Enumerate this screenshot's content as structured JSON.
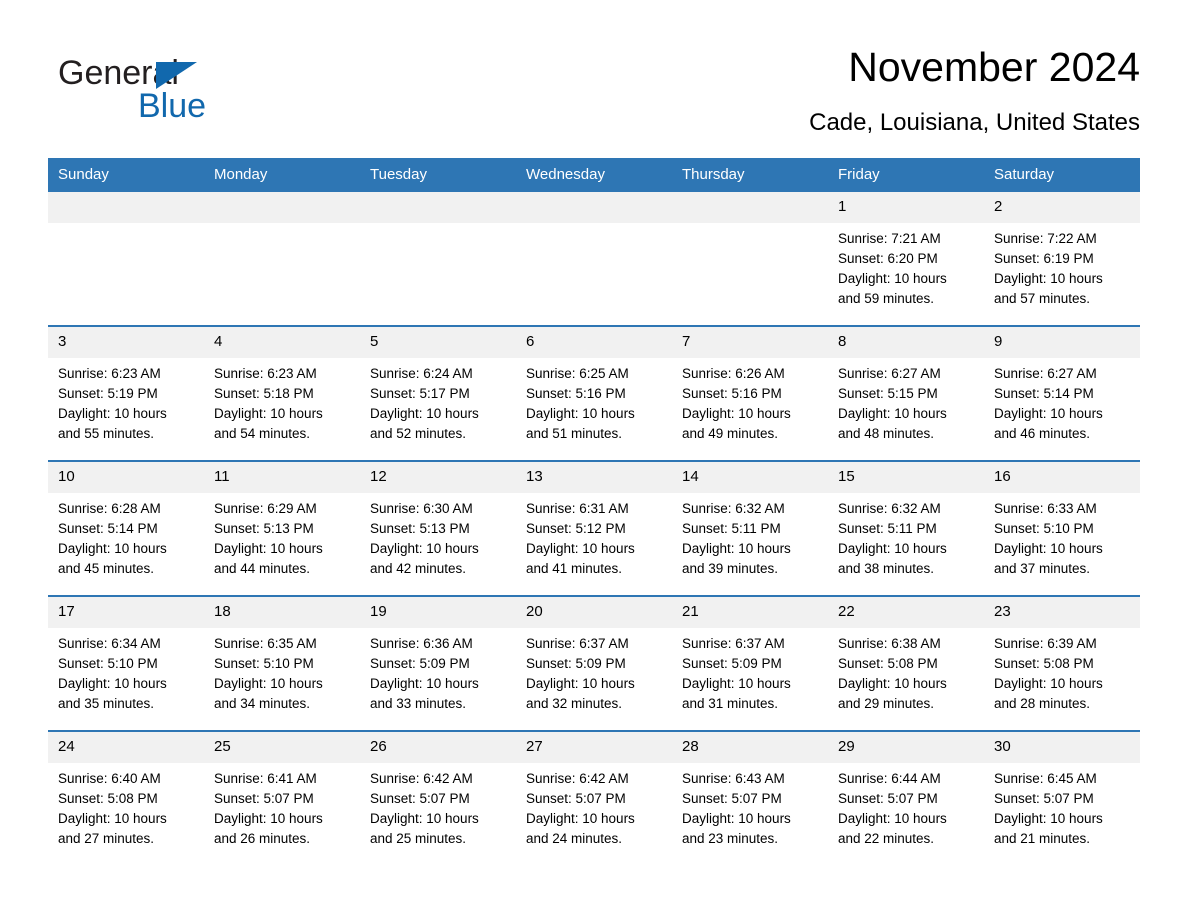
{
  "brand": {
    "name_part1": "General",
    "name_part2": "Blue",
    "triangle_icon": "triangle-icon",
    "accent_color": "#1168ad"
  },
  "header": {
    "month_title": "November 2024",
    "location": "Cade, Louisiana, United States"
  },
  "theme": {
    "header_blue": "#2e76b4",
    "daynum_band": "#f1f1f1",
    "text": "#000000"
  },
  "weekdays": [
    "Sunday",
    "Monday",
    "Tuesday",
    "Wednesday",
    "Thursday",
    "Friday",
    "Saturday"
  ],
  "weeks": [
    [
      {
        "day": "",
        "sunrise": "",
        "sunset": "",
        "daylight_line1": "",
        "daylight_line2": ""
      },
      {
        "day": "",
        "sunrise": "",
        "sunset": "",
        "daylight_line1": "",
        "daylight_line2": ""
      },
      {
        "day": "",
        "sunrise": "",
        "sunset": "",
        "daylight_line1": "",
        "daylight_line2": ""
      },
      {
        "day": "",
        "sunrise": "",
        "sunset": "",
        "daylight_line1": "",
        "daylight_line2": ""
      },
      {
        "day": "",
        "sunrise": "",
        "sunset": "",
        "daylight_line1": "",
        "daylight_line2": ""
      },
      {
        "day": "1",
        "sunrise": "Sunrise: 7:21 AM",
        "sunset": "Sunset: 6:20 PM",
        "daylight_line1": "Daylight: 10 hours",
        "daylight_line2": "and 59 minutes."
      },
      {
        "day": "2",
        "sunrise": "Sunrise: 7:22 AM",
        "sunset": "Sunset: 6:19 PM",
        "daylight_line1": "Daylight: 10 hours",
        "daylight_line2": "and 57 minutes."
      }
    ],
    [
      {
        "day": "3",
        "sunrise": "Sunrise: 6:23 AM",
        "sunset": "Sunset: 5:19 PM",
        "daylight_line1": "Daylight: 10 hours",
        "daylight_line2": "and 55 minutes."
      },
      {
        "day": "4",
        "sunrise": "Sunrise: 6:23 AM",
        "sunset": "Sunset: 5:18 PM",
        "daylight_line1": "Daylight: 10 hours",
        "daylight_line2": "and 54 minutes."
      },
      {
        "day": "5",
        "sunrise": "Sunrise: 6:24 AM",
        "sunset": "Sunset: 5:17 PM",
        "daylight_line1": "Daylight: 10 hours",
        "daylight_line2": "and 52 minutes."
      },
      {
        "day": "6",
        "sunrise": "Sunrise: 6:25 AM",
        "sunset": "Sunset: 5:16 PM",
        "daylight_line1": "Daylight: 10 hours",
        "daylight_line2": "and 51 minutes."
      },
      {
        "day": "7",
        "sunrise": "Sunrise: 6:26 AM",
        "sunset": "Sunset: 5:16 PM",
        "daylight_line1": "Daylight: 10 hours",
        "daylight_line2": "and 49 minutes."
      },
      {
        "day": "8",
        "sunrise": "Sunrise: 6:27 AM",
        "sunset": "Sunset: 5:15 PM",
        "daylight_line1": "Daylight: 10 hours",
        "daylight_line2": "and 48 minutes."
      },
      {
        "day": "9",
        "sunrise": "Sunrise: 6:27 AM",
        "sunset": "Sunset: 5:14 PM",
        "daylight_line1": "Daylight: 10 hours",
        "daylight_line2": "and 46 minutes."
      }
    ],
    [
      {
        "day": "10",
        "sunrise": "Sunrise: 6:28 AM",
        "sunset": "Sunset: 5:14 PM",
        "daylight_line1": "Daylight: 10 hours",
        "daylight_line2": "and 45 minutes."
      },
      {
        "day": "11",
        "sunrise": "Sunrise: 6:29 AM",
        "sunset": "Sunset: 5:13 PM",
        "daylight_line1": "Daylight: 10 hours",
        "daylight_line2": "and 44 minutes."
      },
      {
        "day": "12",
        "sunrise": "Sunrise: 6:30 AM",
        "sunset": "Sunset: 5:13 PM",
        "daylight_line1": "Daylight: 10 hours",
        "daylight_line2": "and 42 minutes."
      },
      {
        "day": "13",
        "sunrise": "Sunrise: 6:31 AM",
        "sunset": "Sunset: 5:12 PM",
        "daylight_line1": "Daylight: 10 hours",
        "daylight_line2": "and 41 minutes."
      },
      {
        "day": "14",
        "sunrise": "Sunrise: 6:32 AM",
        "sunset": "Sunset: 5:11 PM",
        "daylight_line1": "Daylight: 10 hours",
        "daylight_line2": "and 39 minutes."
      },
      {
        "day": "15",
        "sunrise": "Sunrise: 6:32 AM",
        "sunset": "Sunset: 5:11 PM",
        "daylight_line1": "Daylight: 10 hours",
        "daylight_line2": "and 38 minutes."
      },
      {
        "day": "16",
        "sunrise": "Sunrise: 6:33 AM",
        "sunset": "Sunset: 5:10 PM",
        "daylight_line1": "Daylight: 10 hours",
        "daylight_line2": "and 37 minutes."
      }
    ],
    [
      {
        "day": "17",
        "sunrise": "Sunrise: 6:34 AM",
        "sunset": "Sunset: 5:10 PM",
        "daylight_line1": "Daylight: 10 hours",
        "daylight_line2": "and 35 minutes."
      },
      {
        "day": "18",
        "sunrise": "Sunrise: 6:35 AM",
        "sunset": "Sunset: 5:10 PM",
        "daylight_line1": "Daylight: 10 hours",
        "daylight_line2": "and 34 minutes."
      },
      {
        "day": "19",
        "sunrise": "Sunrise: 6:36 AM",
        "sunset": "Sunset: 5:09 PM",
        "daylight_line1": "Daylight: 10 hours",
        "daylight_line2": "and 33 minutes."
      },
      {
        "day": "20",
        "sunrise": "Sunrise: 6:37 AM",
        "sunset": "Sunset: 5:09 PM",
        "daylight_line1": "Daylight: 10 hours",
        "daylight_line2": "and 32 minutes."
      },
      {
        "day": "21",
        "sunrise": "Sunrise: 6:37 AM",
        "sunset": "Sunset: 5:09 PM",
        "daylight_line1": "Daylight: 10 hours",
        "daylight_line2": "and 31 minutes."
      },
      {
        "day": "22",
        "sunrise": "Sunrise: 6:38 AM",
        "sunset": "Sunset: 5:08 PM",
        "daylight_line1": "Daylight: 10 hours",
        "daylight_line2": "and 29 minutes."
      },
      {
        "day": "23",
        "sunrise": "Sunrise: 6:39 AM",
        "sunset": "Sunset: 5:08 PM",
        "daylight_line1": "Daylight: 10 hours",
        "daylight_line2": "and 28 minutes."
      }
    ],
    [
      {
        "day": "24",
        "sunrise": "Sunrise: 6:40 AM",
        "sunset": "Sunset: 5:08 PM",
        "daylight_line1": "Daylight: 10 hours",
        "daylight_line2": "and 27 minutes."
      },
      {
        "day": "25",
        "sunrise": "Sunrise: 6:41 AM",
        "sunset": "Sunset: 5:07 PM",
        "daylight_line1": "Daylight: 10 hours",
        "daylight_line2": "and 26 minutes."
      },
      {
        "day": "26",
        "sunrise": "Sunrise: 6:42 AM",
        "sunset": "Sunset: 5:07 PM",
        "daylight_line1": "Daylight: 10 hours",
        "daylight_line2": "and 25 minutes."
      },
      {
        "day": "27",
        "sunrise": "Sunrise: 6:42 AM",
        "sunset": "Sunset: 5:07 PM",
        "daylight_line1": "Daylight: 10 hours",
        "daylight_line2": "and 24 minutes."
      },
      {
        "day": "28",
        "sunrise": "Sunrise: 6:43 AM",
        "sunset": "Sunset: 5:07 PM",
        "daylight_line1": "Daylight: 10 hours",
        "daylight_line2": "and 23 minutes."
      },
      {
        "day": "29",
        "sunrise": "Sunrise: 6:44 AM",
        "sunset": "Sunset: 5:07 PM",
        "daylight_line1": "Daylight: 10 hours",
        "daylight_line2": "and 22 minutes."
      },
      {
        "day": "30",
        "sunrise": "Sunrise: 6:45 AM",
        "sunset": "Sunset: 5:07 PM",
        "daylight_line1": "Daylight: 10 hours",
        "daylight_line2": "and 21 minutes."
      }
    ]
  ]
}
